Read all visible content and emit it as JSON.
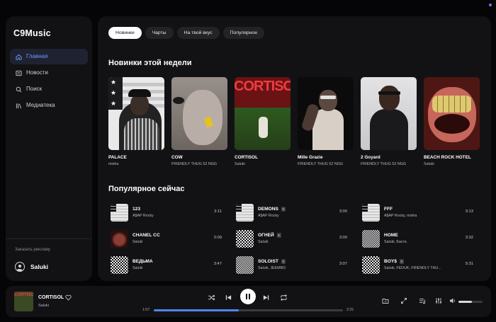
{
  "app": {
    "title": "C9Music"
  },
  "sidebar": {
    "items": [
      {
        "label": "Главная",
        "icon": "home-icon",
        "active": true
      },
      {
        "label": "Новости",
        "icon": "news-icon"
      },
      {
        "label": "Поиск",
        "icon": "search-icon"
      },
      {
        "label": "Медиатека",
        "icon": "library-icon"
      }
    ],
    "ad_label": "Заказать рекламу",
    "user_name": "Saluki"
  },
  "tabs": [
    {
      "label": "Новинки",
      "active": true
    },
    {
      "label": "Чарты"
    },
    {
      "label": "На твой вкус"
    },
    {
      "label": "Популярное"
    }
  ],
  "new_releases": {
    "title": "Новинки этой недели",
    "items": [
      {
        "title": "PALACE",
        "artist": "misha"
      },
      {
        "title": "COW",
        "artist": "FRIENDLY THUG 52 NGG"
      },
      {
        "title": "CORTISOL",
        "artist": "Saluki",
        "cover_text": "CORTISOL"
      },
      {
        "title": "Mille Grazie",
        "artist": "FRIENDLY THUG 52 NGG"
      },
      {
        "title": "2 Goyard",
        "artist": "FRIENDLY THUG 52 NGG"
      },
      {
        "title": "BEACH ROCK HOTEL",
        "artist": "Saluki"
      }
    ]
  },
  "popular": {
    "title": "Популярное сейчас",
    "tracks": [
      {
        "title": "123",
        "artist": "A$AP Rocky",
        "duration": "3:11",
        "explicit": false
      },
      {
        "title": "DEMONS",
        "artist": "A$AP Rocky",
        "duration": "3:00",
        "explicit": true
      },
      {
        "title": "FFF",
        "artist": "A$AP Rocky, misha",
        "duration": "3:13",
        "explicit": false
      },
      {
        "title": "CHANEL CC",
        "artist": "Saluki",
        "duration": "2:09",
        "explicit": false
      },
      {
        "title": "ОГНЕЙ",
        "artist": "Saluki",
        "duration": "3:00",
        "explicit": true
      },
      {
        "title": "HOME",
        "artist": "Saluki, Баста",
        "duration": "3:32",
        "explicit": false
      },
      {
        "title": "ВЕДЬМА",
        "artist": "Saluki",
        "duration": "3:47",
        "explicit": false
      },
      {
        "title": "SOLOIST",
        "artist": "Saluki, JEEMBO",
        "duration": "3:07",
        "explicit": true
      },
      {
        "title": "BOY$",
        "artist": "Saluki, FEDUK, FRIENDLY THU...",
        "duration": "5:31",
        "explicit": true
      }
    ],
    "explicit_mark": "E"
  },
  "player": {
    "title": "CORTISOL",
    "artist": "Saluki",
    "cover_text": "CORTISOL",
    "elapsed": "1:07",
    "total": "2:31",
    "progress": 0.45,
    "volume": 0.55
  },
  "colors": {
    "accent": "#4f84f0",
    "bg": "#121215"
  }
}
